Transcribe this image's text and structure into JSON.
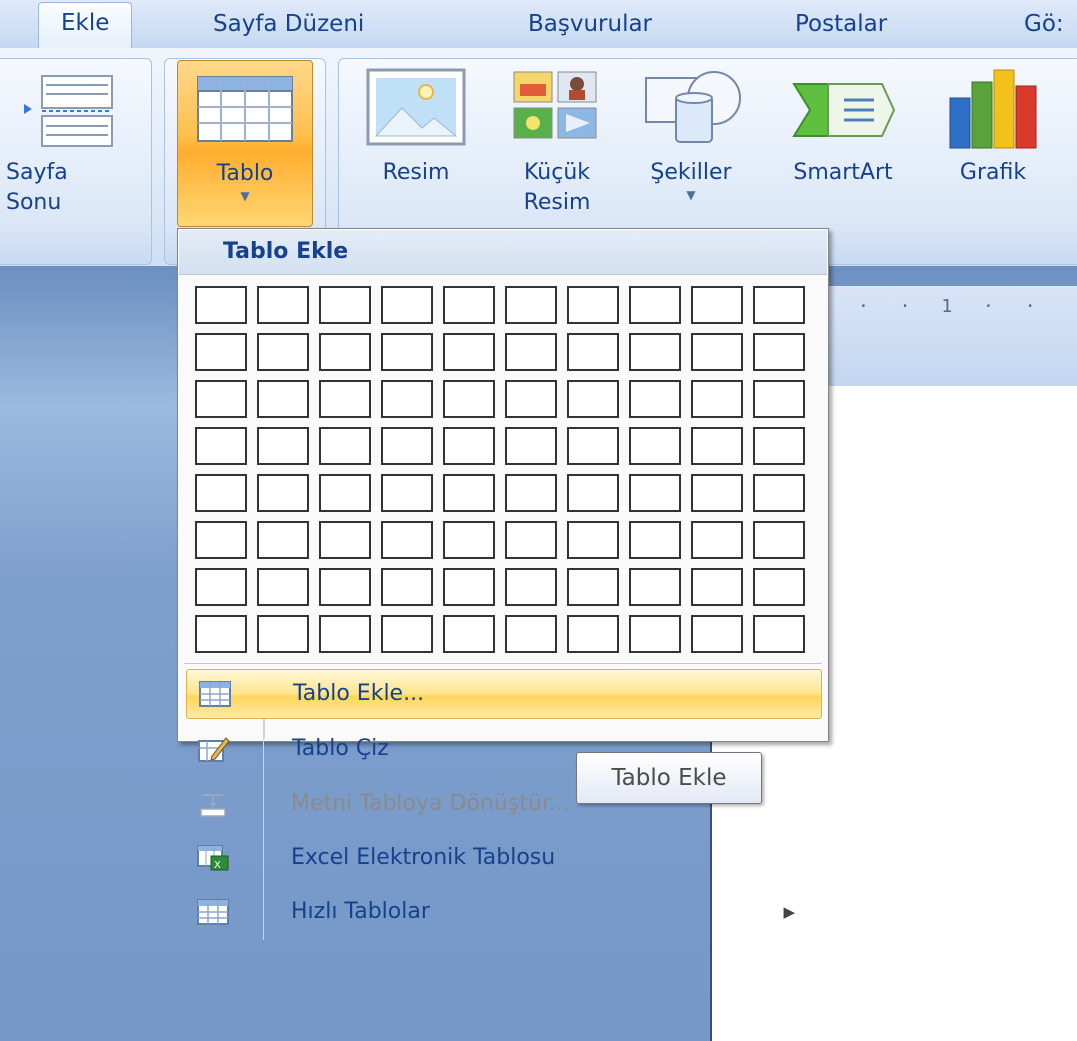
{
  "tabs": {
    "active": "Ekle",
    "items": [
      "Sayfa Düzeni",
      "Başvurular",
      "Postalar",
      "Gö:"
    ]
  },
  "ribbon": {
    "page_break": {
      "line1": "Sayfa",
      "line2": "Sonu"
    },
    "table": {
      "label": "Tablo"
    },
    "picture": {
      "label": "Resim"
    },
    "clipart": {
      "line1": "Küçük",
      "line2": "Resim"
    },
    "shapes": {
      "label": "Şekiller"
    },
    "smartart": {
      "label": "SmartArt"
    },
    "chart": {
      "label": "Grafik"
    }
  },
  "ruler": {
    "text": "· · 1 · ·"
  },
  "menu": {
    "title": "Tablo Ekle",
    "grid": {
      "columns": 10,
      "rows": 8
    },
    "items": [
      {
        "label": "Tablo Ekle...",
        "icon": "table-icon",
        "highlighted": true
      },
      {
        "label": "Tablo Çiz",
        "icon": "draw-table-icon"
      },
      {
        "label": "Metni Tabloya Dönüştür...",
        "icon": "convert-text-icon",
        "disabled": true
      },
      {
        "label": "Excel Elektronik Tablosu",
        "icon": "excel-icon"
      },
      {
        "label": "Hızlı Tablolar",
        "icon": "quick-tables-icon",
        "submenu": true
      }
    ]
  },
  "tooltip": {
    "text": "Tablo Ekle"
  },
  "colors": {
    "accent": "#15428b",
    "highlight": "#ffd65a",
    "doc_bg": "#7598c9"
  }
}
